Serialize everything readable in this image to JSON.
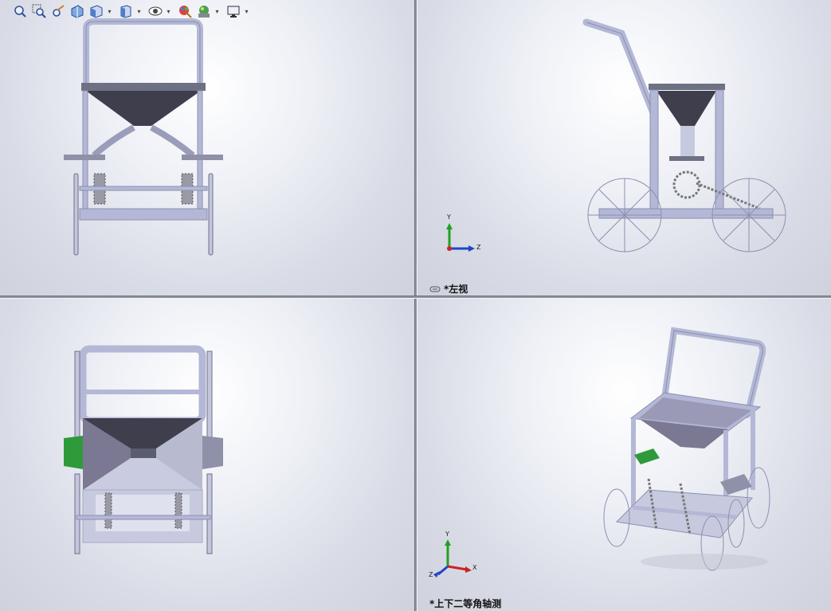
{
  "toolbar": {
    "buttons": [
      {
        "icon": "zoom-to-fit-icon"
      },
      {
        "icon": "zoom-to-area-icon"
      },
      {
        "icon": "previous-view-icon"
      },
      {
        "icon": "section-view-icon"
      },
      {
        "icon": "view-orientation-icon",
        "dropdown": true
      },
      {
        "icon": "display-style-icon",
        "dropdown": true
      },
      {
        "icon": "hide-show-items-icon",
        "dropdown": true
      },
      {
        "icon": "edit-appearance-icon"
      },
      {
        "icon": "apply-scene-icon",
        "dropdown": true
      },
      {
        "icon": "view-settings-icon",
        "dropdown": true
      }
    ],
    "dropdown_glyph": "▾"
  },
  "viewports": {
    "top_left": {
      "label": ""
    },
    "top_right": {
      "label": "*左视",
      "link_icon": "link-views-icon"
    },
    "bottom_left": {
      "label": ""
    },
    "bottom_right": {
      "label": "*上下二等角轴测"
    }
  },
  "triad": {
    "y": "Y",
    "z": "Z",
    "x": "X"
  },
  "colors": {
    "frame": "#b4b8d6",
    "frame_dark": "#8c90b0",
    "hopper": "#3e3e4c",
    "green_part": "#2f9a3a",
    "axis_x": "#cc2222",
    "axis_y": "#22a022",
    "axis_z": "#2244cc"
  }
}
